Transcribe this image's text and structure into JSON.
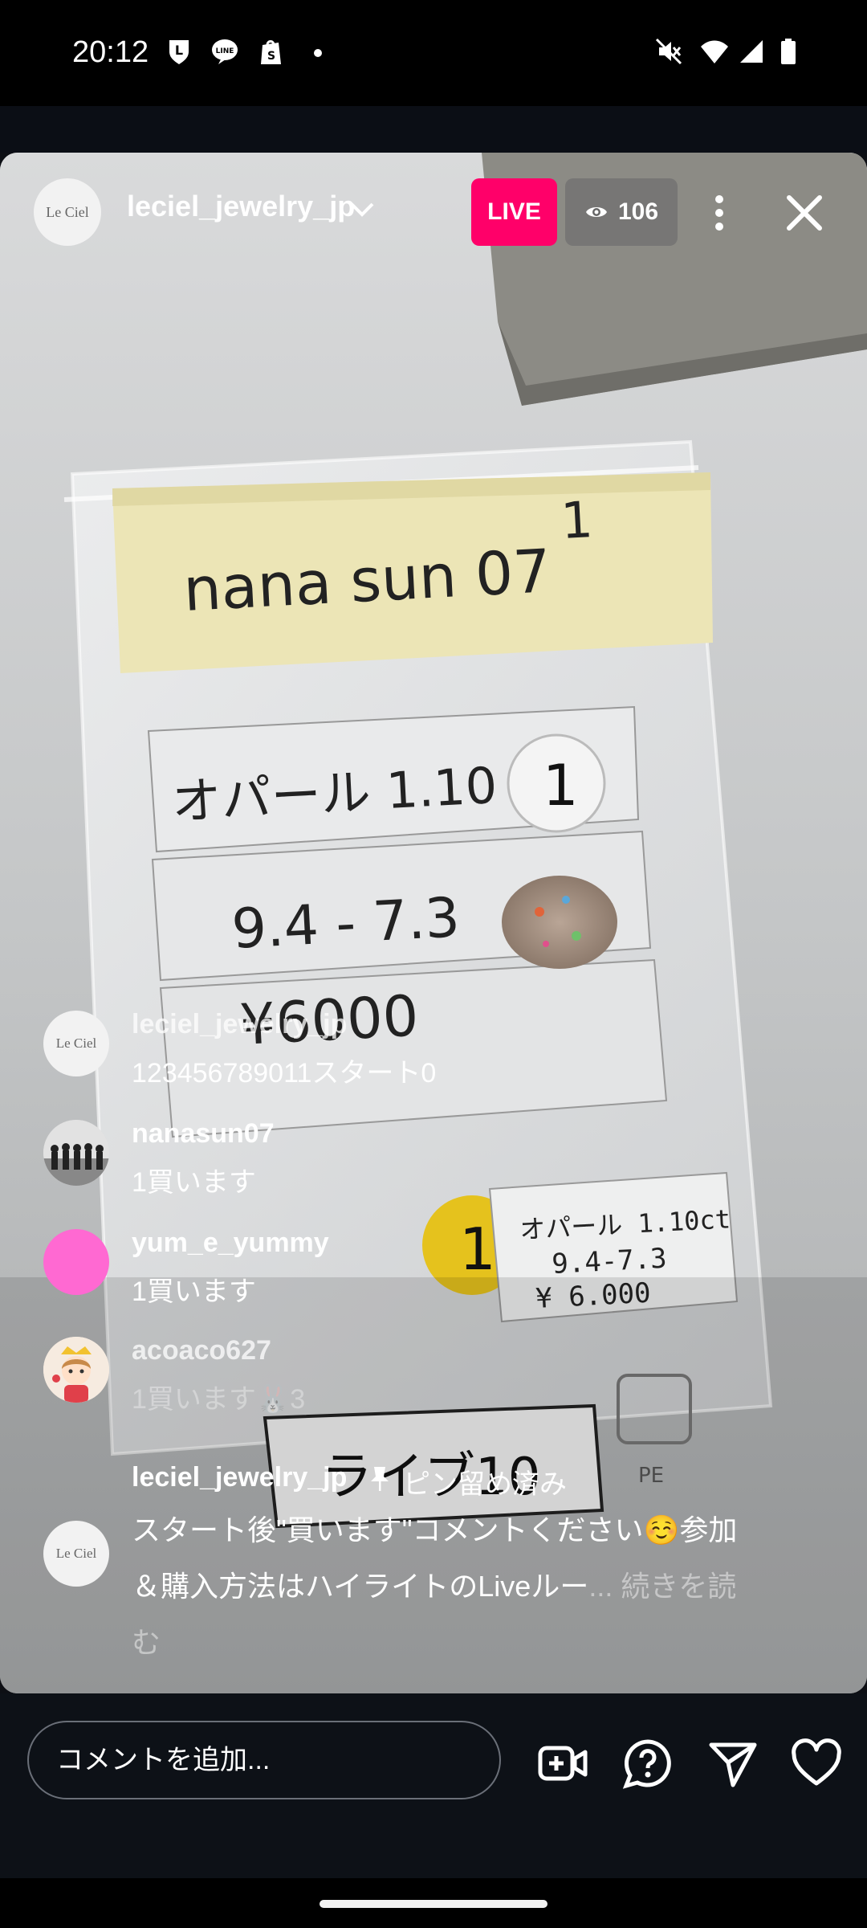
{
  "status_bar": {
    "time": "20:12",
    "left_icons": [
      "line-app-icon",
      "line-chat-icon",
      "shopify-icon",
      "dot-icon"
    ],
    "right_icons": [
      "mute-icon",
      "wifi-icon",
      "signal-icon",
      "battery-icon"
    ]
  },
  "header": {
    "account_name": "leciel_jewelry_jp",
    "avatar_text": "Le Ciel",
    "live_label": "LIVE",
    "viewer_count": "106"
  },
  "video": {
    "note_label": "nana sun 07",
    "note_number": "1",
    "item_name": "オパール 1.10",
    "item_size": "9.4 - 7.3",
    "item_price": "¥6000",
    "tag_line1": "オパール 1.10ct",
    "tag_line2": "9.4-7.3",
    "tag_line3": "¥ 6.000",
    "sticker_number": "1",
    "live_card": "ライブ10",
    "pe_mark": "PE"
  },
  "comments": [
    {
      "user": "leciel_jewelry_jp",
      "text": "123456789011スタート0",
      "avatar": "Le Ciel"
    },
    {
      "user": "nanasun07",
      "text": "1買います",
      "avatar": ""
    },
    {
      "user": "yum_e_yummy",
      "text": "1買います",
      "avatar": ""
    },
    {
      "user": "acoaco627",
      "text": "1買います🐰3",
      "avatar": ""
    }
  ],
  "pinned": {
    "user": "leciel_jewelry_jp",
    "pinned_label": "ピン留め済み",
    "text": "スタート後\"買います\"コメントください☺️参加＆購入方法はハイライトのLiveルー",
    "more_label": "... 続きを読む",
    "avatar": "Le Ciel"
  },
  "footer": {
    "comment_placeholder": "コメントを追加..."
  },
  "colors": {
    "live_badge": "#ff0069",
    "background": "#0d0f14",
    "yum_avatar": "#ff69d2"
  }
}
